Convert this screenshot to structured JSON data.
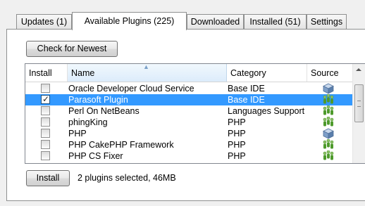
{
  "tabs": [
    {
      "label": "Updates (1)"
    },
    {
      "label": "Available Plugins (225)"
    },
    {
      "label": "Downloaded"
    },
    {
      "label": "Installed (51)"
    },
    {
      "label": "Settings"
    }
  ],
  "active_tab": "Available Plugins (225)",
  "buttons": {
    "check_newest": "Check for Newest",
    "install": "Install"
  },
  "table": {
    "columns": [
      "Install",
      "Name",
      "Category",
      "Source"
    ],
    "sorted_column": "Name",
    "rows": [
      {
        "checked": false,
        "name": "Oracle Developer Cloud Service",
        "category": "Base IDE",
        "source_icon": "box-icon",
        "selected": false
      },
      {
        "checked": true,
        "name": "Parasoft Plugin",
        "category": "Base IDE",
        "source_icon": "community-icon",
        "selected": true
      },
      {
        "checked": false,
        "name": "Perl On NetBeans",
        "category": "Languages Support",
        "source_icon": "community-icon",
        "selected": false
      },
      {
        "checked": false,
        "name": "phingKing",
        "category": "PHP",
        "source_icon": "community-icon",
        "selected": false
      },
      {
        "checked": false,
        "name": "PHP",
        "category": "PHP",
        "source_icon": "box-icon",
        "selected": false
      },
      {
        "checked": false,
        "name": "PHP CakePHP Framework",
        "category": "PHP",
        "source_icon": "community-icon",
        "selected": false
      },
      {
        "checked": false,
        "name": "PHP CS Fixer",
        "category": "PHP",
        "source_icon": "community-icon",
        "selected": false
      }
    ]
  },
  "status_text": "2 plugins selected, 46MB",
  "colors": {
    "selection": "#3399ff",
    "box_icon": "#7e9fc8",
    "community_icon": "#4e9a2c"
  }
}
